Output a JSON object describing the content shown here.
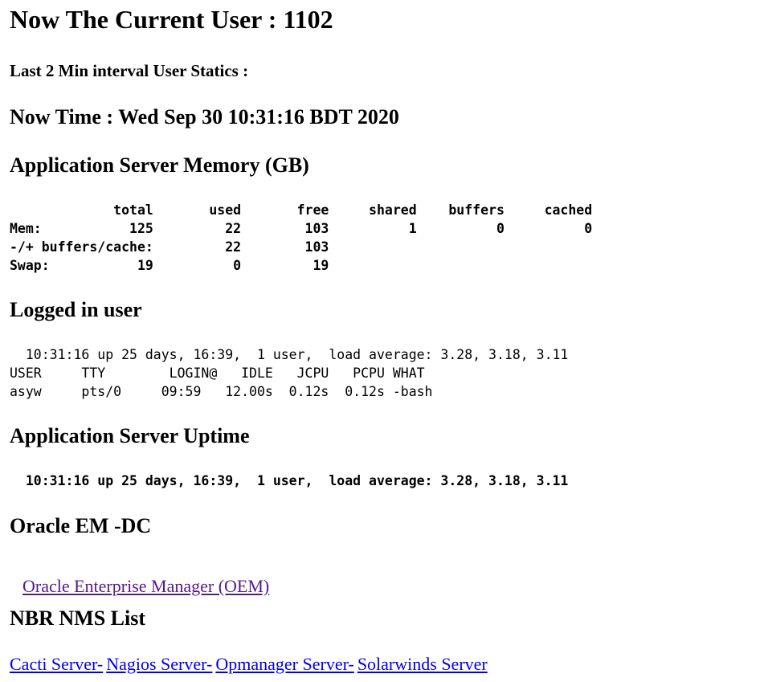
{
  "header": {
    "current_user": "Now The Current User : 1102",
    "interval_title": "Last 2 Min interval User Statics :",
    "now_time": "Now Time : Wed Sep 30 10:31:16 BDT 2020"
  },
  "memory": {
    "title": "Application Server Memory (GB)",
    "lines": [
      "             total       used       free     shared    buffers     cached",
      "Mem:           125         22        103          1          0          0",
      "-/+ buffers/cache:         22        103",
      "Swap:           19          0         19"
    ]
  },
  "logged_in": {
    "title": "Logged in user",
    "lines": [
      "  10:31:16 up 25 days, 16:39,  1 user,  load average: 3.28, 3.18, 3.11",
      "USER     TTY        LOGIN@   IDLE   JCPU   PCPU WHAT",
      "asyw     pts/0     09:59   12.00s  0.12s  0.12s -bash"
    ]
  },
  "uptime": {
    "title": "Application Server Uptime",
    "line": "  10:31:16 up 25 days, 16:39,  1 user,  load average: 3.28, 3.18, 3.11"
  },
  "oracle": {
    "title": "Oracle EM -DC",
    "link_label": "Oracle Enterprise Manager (OEM)"
  },
  "nms": {
    "title": "NBR NMS List",
    "links": [
      "Cacti Server-",
      "Nagios Server-",
      "Opmanager Server-",
      "Solarwinds Server"
    ]
  },
  "colors": {
    "link_unvisited": "#0000ee",
    "link_visited": "#551a8b",
    "text": "#000000",
    "background": "#ffffff"
  }
}
